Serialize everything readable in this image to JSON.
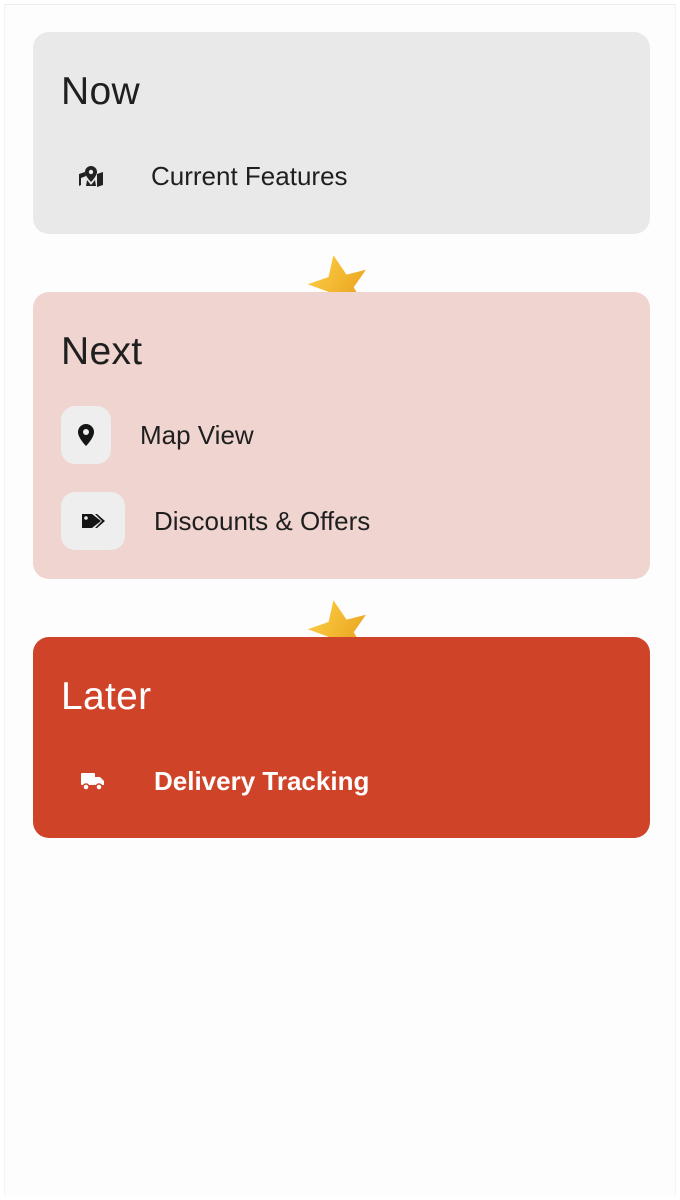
{
  "stages": [
    {
      "title": "Now",
      "items": [
        {
          "label": "Current Features",
          "icon": "map-marked-icon"
        }
      ]
    },
    {
      "title": "Next",
      "items": [
        {
          "label": "Map View",
          "icon": "map-pin-icon"
        },
        {
          "label": "Discounts & Offers",
          "icon": "tags-icon"
        }
      ]
    },
    {
      "title": "Later",
      "items": [
        {
          "label": "Delivery Tracking",
          "icon": "truck-icon"
        }
      ]
    }
  ],
  "connector_icon": "star-icon",
  "colors": {
    "now_bg": "#e9e9e9",
    "next_bg": "#efd4d0",
    "later_bg": "#cf4329",
    "star": "#f5b82e"
  }
}
